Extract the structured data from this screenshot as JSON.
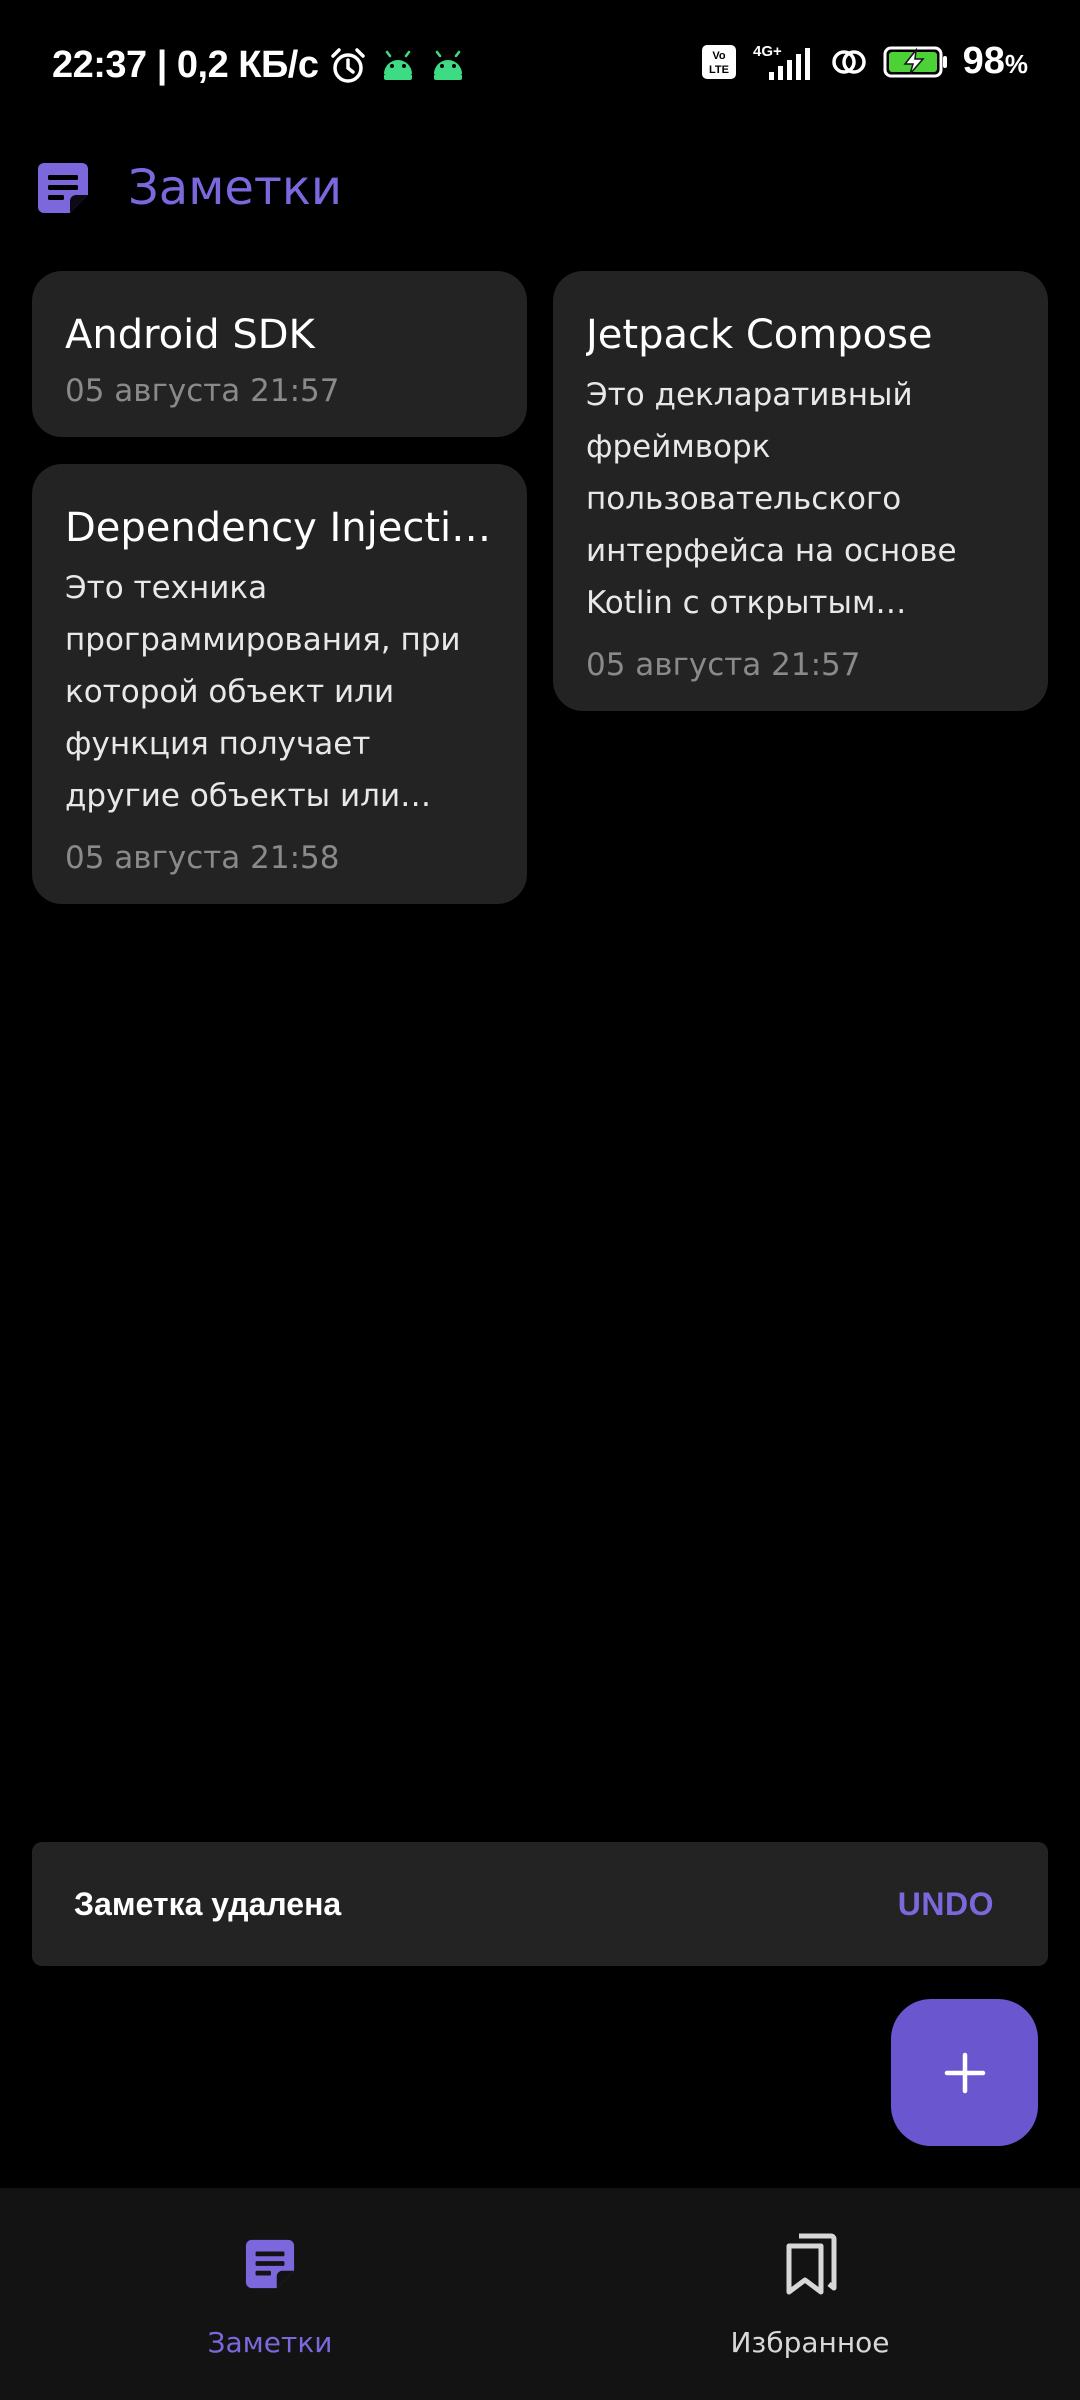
{
  "status_bar": {
    "time": "22:37",
    "speed": "| 0,2 КБ/с",
    "volte": "Vo LTE",
    "network": "4G+",
    "battery_value": "98",
    "battery_unit": "%"
  },
  "header": {
    "title": "Заметки"
  },
  "notes": [
    {
      "title": "Android SDK",
      "body": "",
      "date": "05 августа 21:57"
    },
    {
      "title": "Jetpack Compose",
      "body": "Это декларативный фреймворк пользовательского интерфейса на основе Kotlin с открытым исходным кодом",
      "date": "05 августа 21:57"
    },
    {
      "title": "Dependency Injection",
      "body": "Это техника программирования, при которой объект или функция получает другие объекты или функции, которые ему необходимы",
      "date": "05 августа 21:58"
    }
  ],
  "snackbar": {
    "message": "Заметка удалена",
    "action": "UNDO"
  },
  "fab": {
    "icon": "plus-icon"
  },
  "bottom_nav": {
    "items": [
      {
        "label": "Заметки",
        "icon": "notes-icon",
        "active": true
      },
      {
        "label": "Избранное",
        "icon": "bookmarks-icon",
        "active": false
      }
    ]
  },
  "colors": {
    "accent": "#7c68dc",
    "fab": "#6a56cf",
    "card": "#232323",
    "background": "#000000",
    "nav_background": "#131313",
    "battery": "#4cd137"
  }
}
